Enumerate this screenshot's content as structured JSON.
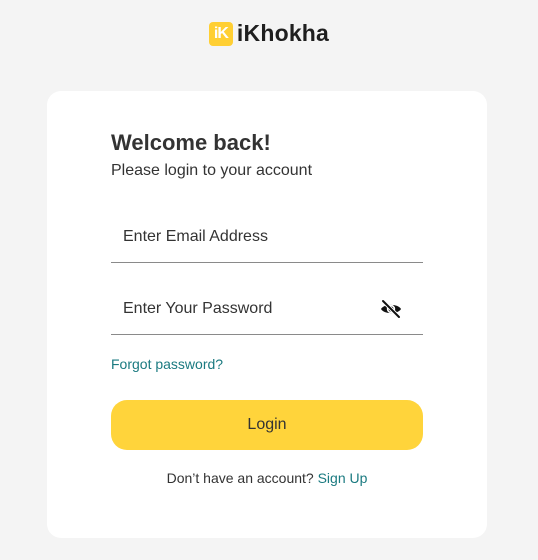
{
  "brand": {
    "mark": "iK",
    "name": "iKhokha",
    "accent_color": "#ffcf33"
  },
  "login": {
    "title": "Welcome back!",
    "subtitle": "Please login to your account",
    "email": {
      "placeholder": "Enter Email Address",
      "value": ""
    },
    "password": {
      "placeholder": "Enter Your Password",
      "value": "",
      "toggle_icon": "eye-slash-icon"
    },
    "forgot_label": "Forgot password?",
    "login_label": "Login",
    "button_color": "#ffd43b",
    "link_color": "#1a7a80",
    "signup_prompt": "Don’t have an account?",
    "signup_label": "Sign Up"
  }
}
